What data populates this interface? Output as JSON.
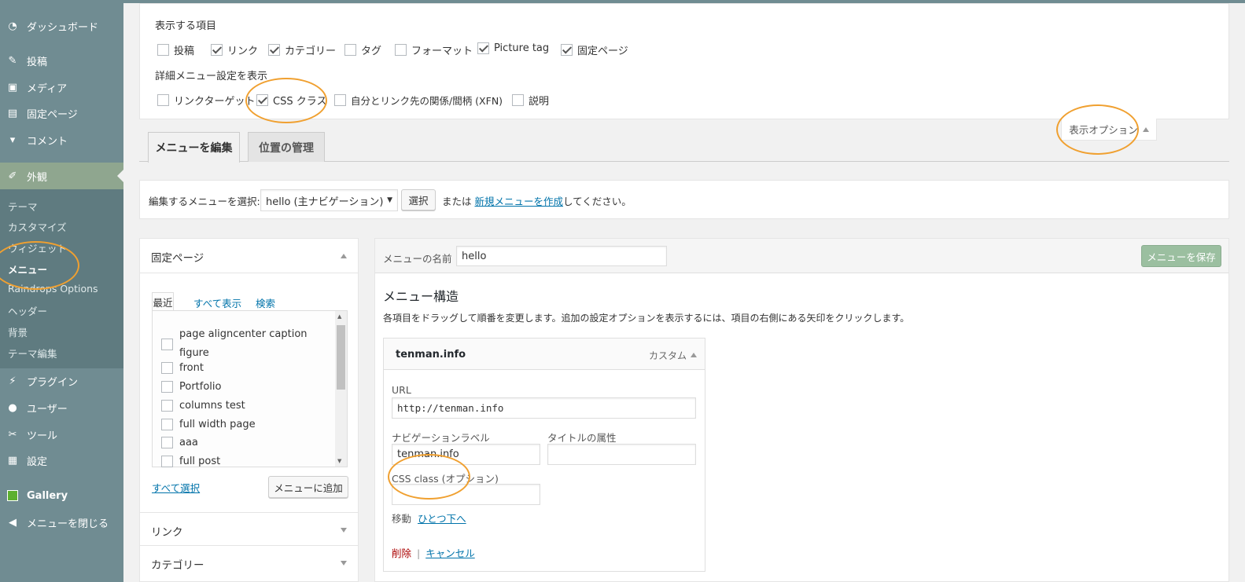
{
  "sidebar": {
    "items": [
      {
        "label": "ダッシュボード",
        "icon": "dashboard-icon"
      },
      {
        "label": "投稿",
        "icon": "pin-icon"
      },
      {
        "label": "メディア",
        "icon": "media-icon"
      },
      {
        "label": "固定ページ",
        "icon": "pages-icon"
      },
      {
        "label": "コメント",
        "icon": "comment-icon"
      },
      {
        "label": "外観",
        "icon": "appearance-brush-icon"
      },
      {
        "label": "プラグイン",
        "icon": "plugin-icon"
      },
      {
        "label": "ユーザー",
        "icon": "user-icon"
      },
      {
        "label": "ツール",
        "icon": "wrench-icon"
      },
      {
        "label": "設定",
        "icon": "settings-icon"
      },
      {
        "label": "Gallery",
        "icon": "gallery-icon"
      },
      {
        "label": "メニューを閉じる",
        "icon": "collapse-icon"
      }
    ],
    "submenu": [
      "テーマ",
      "カスタマイズ",
      "ウィジェット",
      "メニュー",
      "Raindrops Options",
      "ヘッダー",
      "背景",
      "テーマ編集"
    ]
  },
  "screen_options": {
    "title": "表示する項目",
    "items": [
      {
        "label": "投稿",
        "checked": false
      },
      {
        "label": "リンク",
        "checked": true
      },
      {
        "label": "カテゴリー",
        "checked": true
      },
      {
        "label": "タグ",
        "checked": false
      },
      {
        "label": "フォーマット",
        "checked": false
      },
      {
        "label": "Picture tag",
        "checked": true
      },
      {
        "label": "固定ページ",
        "checked": true
      }
    ],
    "advanced_title": "詳細メニュー設定を表示",
    "advanced": [
      {
        "label": "リンクターゲット",
        "checked": false
      },
      {
        "label": "CSS クラス",
        "checked": true
      },
      {
        "label": "自分とリンク先の関係/間柄 (XFN)",
        "checked": false
      },
      {
        "label": "説明",
        "checked": false
      }
    ],
    "toggle_label": "表示オプション"
  },
  "tabs": {
    "edit": "メニューを編集",
    "locations": "位置の管理"
  },
  "select_bar": {
    "label": "編集するメニューを選択:",
    "selected": "hello (主ナビゲーション)",
    "button": "選択",
    "or_text": "または",
    "link": "新規メニューを作成",
    "suffix": "してください。"
  },
  "left_panel": {
    "title": "固定ページ",
    "tabs": [
      "最近",
      "すべて表示",
      "検索"
    ],
    "pages": [
      "page aligncenter caption figure",
      "front",
      "Portfolio",
      "columns test",
      "full width page",
      "aaa",
      "full post"
    ],
    "select_all": "すべて選択",
    "add_button": "メニューに追加",
    "sections": [
      "リンク",
      "カテゴリー"
    ]
  },
  "menu": {
    "name_label": "メニューの名前",
    "name_value": "hello",
    "save_button": "メニューを保存",
    "structure_title": "メニュー構造",
    "instructions": "各項目をドラッグして順番を変更します。追加の設定オプションを表示するには、項目の右側にある矢印をクリックします。",
    "item": {
      "title": "tenman.info",
      "type": "カスタム",
      "url_label": "URL",
      "url_value": "http://tenman.info",
      "nav_label": "ナビゲーションラベル",
      "nav_value": "tenman.info",
      "title_attr_label": "タイトルの属性",
      "title_attr_value": "",
      "css_label": "CSS class (オプション)",
      "css_value": "",
      "move_label": "移動",
      "move_link": "ひとつ下へ",
      "delete": "削除",
      "sep": "|",
      "cancel": "キャンセル"
    }
  },
  "colors": {
    "highlight": "#f0a030",
    "sidebar": "#708c92",
    "active": "#8fa68f",
    "link": "#0073aa"
  }
}
